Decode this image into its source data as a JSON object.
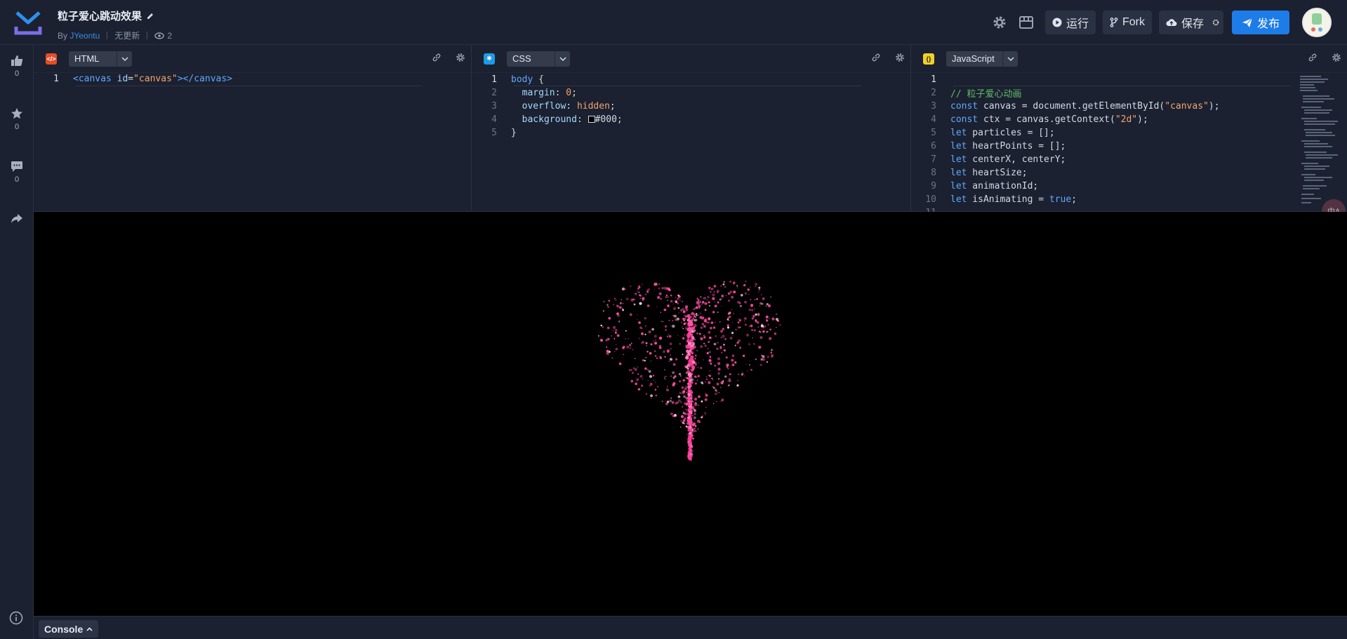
{
  "header": {
    "title": "粒子爱心跳动效果",
    "by_label": "By",
    "author": "JYeontu",
    "update_status": "无更新",
    "views": "2",
    "run_label": "运行",
    "fork_label": "Fork",
    "save_label": "保存",
    "publish_label": "发布"
  },
  "sidebar": {
    "likes": "0",
    "stars": "0",
    "comments": "0"
  },
  "editors": {
    "html": {
      "language": "HTML",
      "lines": [
        "<canvas id=\"canvas\"></canvas>"
      ]
    },
    "css": {
      "language": "CSS",
      "lines": [
        "body {",
        "  margin: 0;",
        "  overflow: hidden;",
        "  background: #000;",
        "}"
      ]
    },
    "js": {
      "language": "JavaScript",
      "lines": [
        "",
        "// 粒子爱心动画",
        "const canvas = document.getElementById(\"canvas\");",
        "const ctx = canvas.getContext(\"2d\");",
        "let particles = [];",
        "let heartPoints = [];",
        "let centerX, centerY;",
        "let heartSize;",
        "let animationId;",
        "let isAnimating = true;",
        ""
      ]
    }
  },
  "console": {
    "label": "Console"
  },
  "colors": {
    "accent": "#1e7ce8",
    "particle": "#ff4fa3",
    "html_badge": "#e44d26",
    "css_badge": "#1e9be6",
    "js_badge": "#f0d02a"
  }
}
